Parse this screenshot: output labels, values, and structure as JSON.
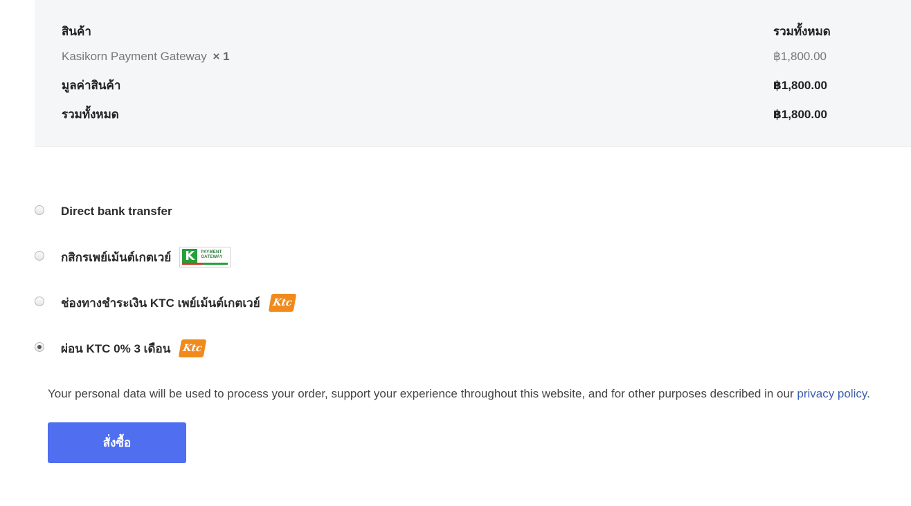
{
  "order": {
    "header_product": "สินค้า",
    "header_total": "รวมทั้งหมด",
    "item": {
      "name": "Kasikorn Payment Gateway",
      "qty": "× 1",
      "price": "฿1,800.00"
    },
    "subtotal_label": "มูลค่าสินค้า",
    "subtotal_value": "฿1,800.00",
    "total_label": "รวมทั้งหมด",
    "total_value": "฿1,800.00"
  },
  "payment_methods": [
    {
      "label": "Direct bank transfer",
      "selected": false,
      "logo": null
    },
    {
      "label": "กสิกรเพย์เม้นต์เกตเวย์",
      "selected": false,
      "logo": "kbank-payment-gateway-logo"
    },
    {
      "label": "ช่องทางชำระเงิน KTC เพย์เม้นต์เกตเวย์",
      "selected": false,
      "logo": "ktc-logo"
    },
    {
      "label": "ผ่อน KTC 0% 3 เดือน",
      "selected": true,
      "logo": "ktc-logo"
    }
  ],
  "kbank_logo": {
    "letter": "K",
    "line1": "PAYMENT",
    "line2": "GATEWAY"
  },
  "ktc_logo_text": "Ktc",
  "privacy": {
    "text": "Your personal data will be used to process your order, support your experience throughout this website, and for other purposes described in our ",
    "link_text": "privacy policy",
    "end": "."
  },
  "place_order_label": "สั่งซื้อ",
  "colors": {
    "button": "#4f6ff0",
    "link": "#3d5fb3",
    "panel": "#f5f6f7",
    "ktc_orange": "#f08a1c",
    "kbank_green": "#23a03a"
  }
}
